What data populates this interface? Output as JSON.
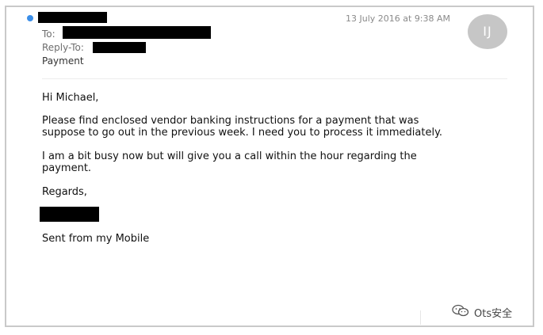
{
  "email": {
    "date": "13 July 2016 at 9:38 AM",
    "avatar_initials": "IJ",
    "to_label": "To:",
    "reply_to_label": "Reply-To:",
    "subject": "Payment",
    "greeting": "Hi Michael,",
    "paragraph1_line1": "Please find enclosed vendor banking instructions for a payment that was",
    "paragraph1_line2": "suppose to go out in the previous week. I need you to process it immediately.",
    "paragraph2_line1": "I am a bit busy now but will give you a call within the hour regarding the",
    "paragraph2_line2": "payment.",
    "closing": "Regards,",
    "signature_line": "Sent from my Mobile",
    "unread_dot_color": "#3b8ee8"
  },
  "watermark": {
    "text": "Ots安全",
    "icon": "wechat-icon"
  }
}
